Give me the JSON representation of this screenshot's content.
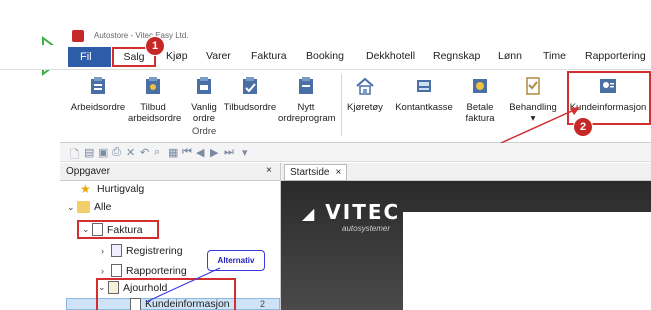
{
  "window": {
    "title": "Autostore - Vitec Easy Ltd."
  },
  "menu": {
    "file": "Fil",
    "items": [
      "Salg",
      "Kjøp",
      "Varer",
      "Faktura",
      "Booking",
      "Dekkhotell",
      "Regnskap",
      "Lønn",
      "Time",
      "Rapportering"
    ]
  },
  "ribbon": {
    "buttons": [
      "Arbeidsordre",
      "Tilbud arbeidsordre",
      "Vanlig ordre",
      "Tilbudsordre",
      "Nytt ordreprogram",
      "Kjøretøy",
      "Kontantkasse",
      "Betale faktura",
      "Behandling",
      "Kundeinformasjon"
    ],
    "group_label": "Ordre",
    "behandling_arrow": "▾"
  },
  "toolbar": {
    "overflow": "▾"
  },
  "panel": {
    "title": "Oppgaver",
    "close": "×",
    "tree": {
      "hurtigvalg": "Hurtigvalg",
      "alle": "Alle",
      "faktura": "Faktura",
      "registrering": "Registrering",
      "rapportering": "Rapportering",
      "ajourhold": "Ajourhold",
      "kundeinformasjon": "Kundeinformasjon",
      "kunde_badge": "2"
    }
  },
  "tabs": {
    "startside": "Startside",
    "close": "×"
  },
  "content": {
    "logo": "VITEC",
    "logo_sub": "autosystemer"
  },
  "annotations": {
    "badge1": "1",
    "badge2": "2",
    "callout": "Alternativ"
  },
  "colors": {
    "accent": "#2d5ca8",
    "highlight_red": "#d32f2f",
    "arrow_green": "#3cb043",
    "callout_blue": "#3a3ae0"
  }
}
